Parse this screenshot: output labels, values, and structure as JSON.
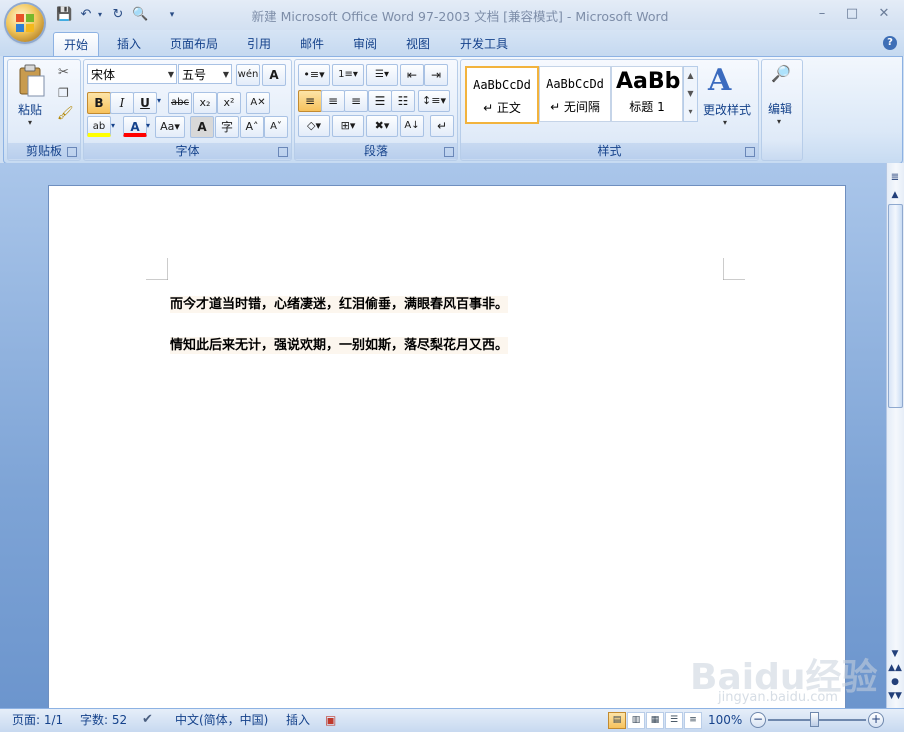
{
  "window": {
    "title": "新建 Microsoft Office Word 97-2003 文档 [兼容模式] - Microsoft Word",
    "minimize": "–",
    "restore": "□",
    "close": "✕"
  },
  "tabs": [
    "开始",
    "插入",
    "页面布局",
    "引用",
    "邮件",
    "审阅",
    "视图",
    "开发工具"
  ],
  "ribbon": {
    "clipboard": {
      "label": "剪贴板",
      "paste": "粘贴"
    },
    "font": {
      "label": "字体",
      "font_name": "宋体",
      "font_size": "五号"
    },
    "paragraph": {
      "label": "段落"
    },
    "styles": {
      "label": "样式",
      "tiles": [
        {
          "sample": "AaBbCcDd",
          "name": "↵ 正文"
        },
        {
          "sample": "AaBbCcDd",
          "name": "↵ 无间隔"
        },
        {
          "sample": "AaBb",
          "name": "标题 1"
        }
      ],
      "change_styles": "更改样式"
    },
    "editing": {
      "label": "编辑"
    }
  },
  "document": {
    "lines": [
      "而今才道当时错，心绪凄迷，红泪偷垂，满眼春风百事非。",
      "情知此后来无计，强说欢期，一别如斯，落尽梨花月又西。"
    ]
  },
  "status": {
    "page": "页面: 1/1",
    "words": "字数: 52",
    "language": "中文(简体，中国)",
    "insert": "插入",
    "zoom": "100%"
  },
  "watermark": {
    "logo": "Baidu经验",
    "url": "jingyan.baidu.com"
  },
  "colors": {
    "accent": "#15428b",
    "highlight": "#ffff00",
    "font_color": "#ff0000",
    "selected_style": "#f2b33d"
  }
}
